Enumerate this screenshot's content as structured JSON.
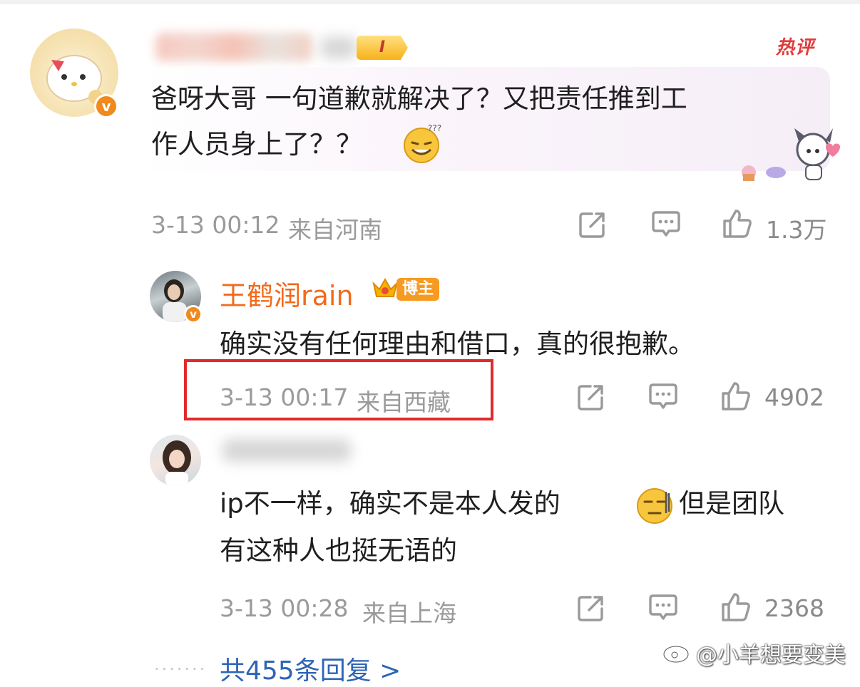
{
  "comment1": {
    "level_badge": "I",
    "hot_tag": "热评",
    "text_line1": "爸呀大哥 一句道歉就解决了？又把责任推到工",
    "text_line2": "作人员身上了？？",
    "emoji": "grin-sweat-emoji",
    "time": "3-13 00:12",
    "location": "来自河南",
    "likes": "1.3万"
  },
  "reply1": {
    "author": "王鹤润rain",
    "badge": "博主",
    "text": "确实没有任何理由和借口，真的很抱歉。",
    "time": "3-13 00:17",
    "location": "来自西藏",
    "likes": "4902"
  },
  "reply2": {
    "text_line1_a": "ip不一样，确实不是本人发的",
    "text_line1_b": "但是团队",
    "text_line2": "有这种人也挺无语的",
    "emoji": "speechless-emoji",
    "time": "3-13 00:28",
    "location": "来自上海",
    "likes": "2368"
  },
  "footer": {
    "more_replies": "共455条回复 >",
    "watermark": "@小羊想要变美"
  },
  "icons": {
    "share": "share-icon",
    "comment": "comment-icon",
    "like": "thumbs-up-icon"
  },
  "colors": {
    "author_orange": "#f26a1b",
    "highlight_red": "#e12a2a",
    "link_blue": "#2e64b5"
  }
}
